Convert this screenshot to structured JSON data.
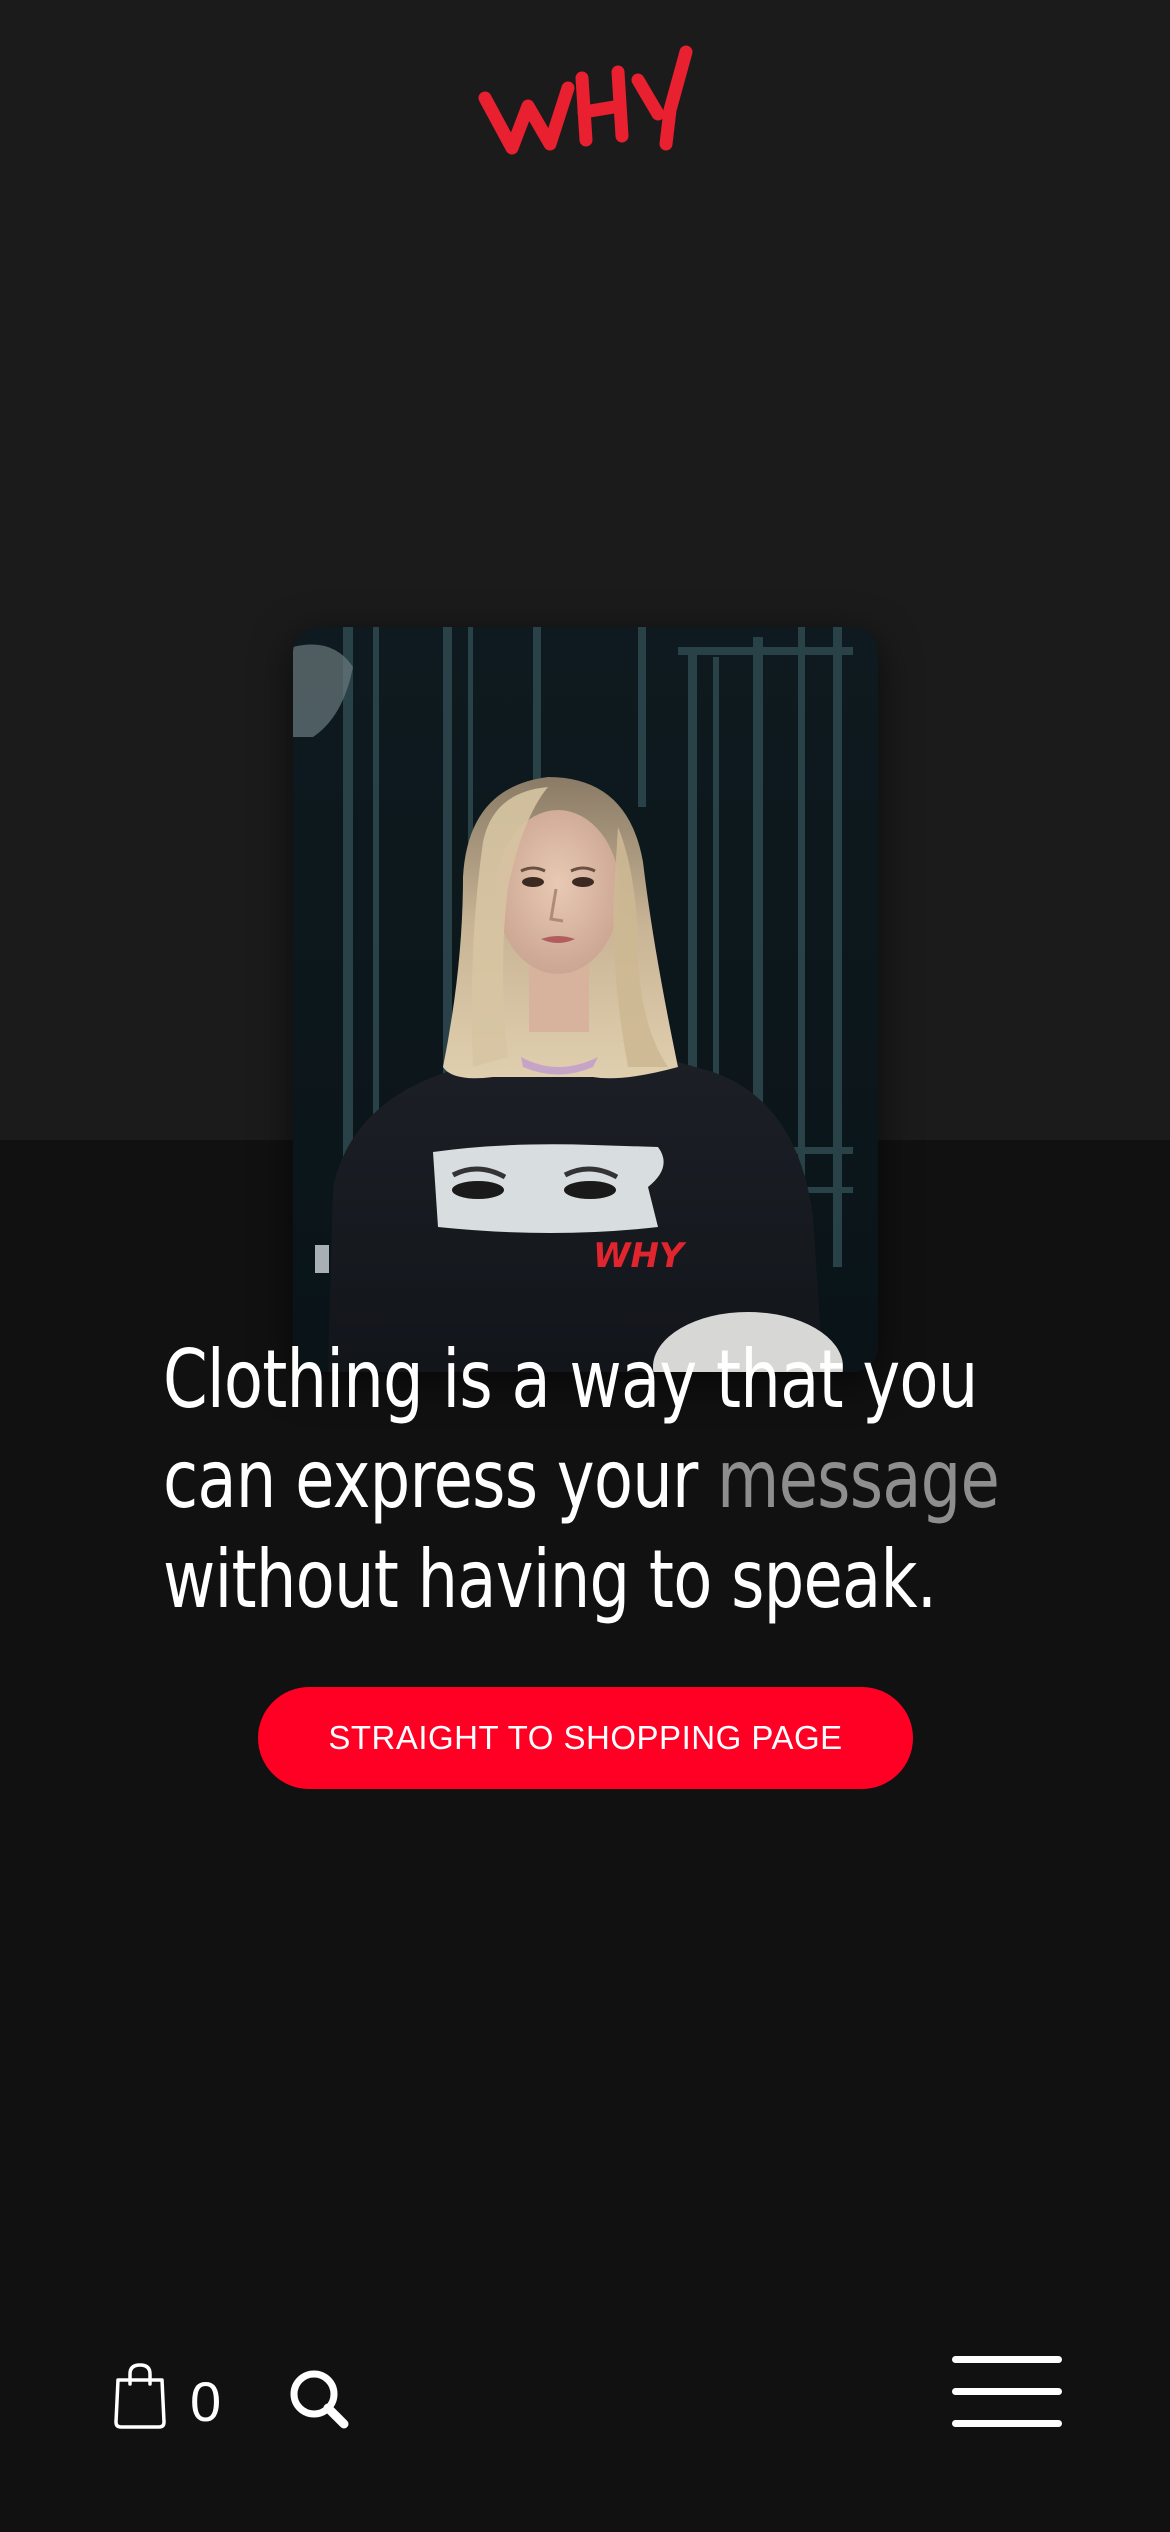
{
  "brand": {
    "logo_text": "WHY",
    "logo_color": "#e8202f"
  },
  "hero": {
    "image_alt": "Model wearing black WHY sweatshirt with eyes print",
    "print_text": "WHY"
  },
  "headline": {
    "line1": "Clothing is a way that you",
    "line2_part1": "can express your ",
    "line2_highlight": "message",
    "line3": "without having to speak."
  },
  "cta": {
    "label": "STRAIGHT TO SHOPPING PAGE",
    "color": "#ff0024"
  },
  "bottom_bar": {
    "cart_icon": "shopping-bag-icon",
    "cart_count": "0",
    "search_icon": "search-icon",
    "menu_icon": "hamburger-menu-icon"
  },
  "colors": {
    "background": "#111111",
    "top_band": "#1b1b1b",
    "text": "#ffffff",
    "muted_text": "#8e8e8e"
  }
}
